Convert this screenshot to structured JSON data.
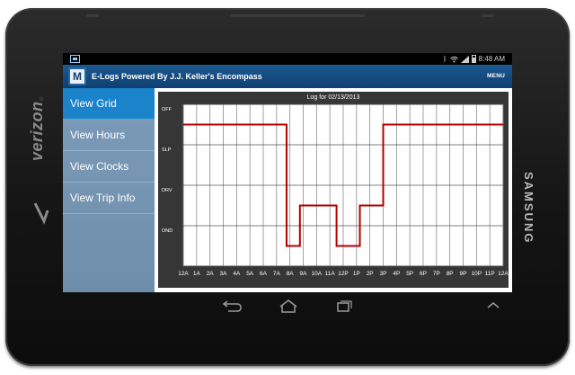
{
  "device": {
    "carrier_logo": "verizon",
    "brand_logo": "SAMSUNG"
  },
  "status_bar": {
    "left_icon": "screenshot-icon",
    "right_icons": [
      "bluetooth-icon",
      "wifi-icon",
      "signal-icon",
      "battery-icon"
    ],
    "time": "8:48 AM"
  },
  "app_bar": {
    "logo_letter": "M",
    "title": "E-Logs Powered By J.J. Keller's Encompass",
    "menu_label": "MENU",
    "color": "#1c5a92"
  },
  "sidebar": {
    "items": [
      {
        "label": "View Grid",
        "active": true
      },
      {
        "label": "View Hours",
        "active": false
      },
      {
        "label": "View Clocks",
        "active": false
      },
      {
        "label": "View Trip Info",
        "active": false
      }
    ],
    "active_color": "#1a83c9"
  },
  "chart_data": {
    "type": "line",
    "title": "Log for 02/13/2013",
    "status_rows": [
      "OFF",
      "SLP",
      "DRV",
      "OND"
    ],
    "x_ticks": [
      "12A",
      "1A",
      "2A",
      "3A",
      "4A",
      "5A",
      "6A",
      "7A",
      "8A",
      "9A",
      "10A",
      "11A",
      "12P",
      "1P",
      "2P",
      "3P",
      "4P",
      "5P",
      "6P",
      "7P",
      "8P",
      "9P",
      "10P",
      "11P",
      "12A"
    ],
    "xlim": [
      0,
      24
    ],
    "grid": true,
    "line_color": "#b30000",
    "segments": [
      {
        "status": "OFF",
        "start": 0,
        "end": 7.75
      },
      {
        "status": "OND",
        "start": 7.75,
        "end": 8.75
      },
      {
        "status": "DRV",
        "start": 8.75,
        "end": 11.5
      },
      {
        "status": "OND",
        "start": 11.5,
        "end": 13.25
      },
      {
        "status": "DRV",
        "start": 13.25,
        "end": 15.0
      },
      {
        "status": "OFF",
        "start": 15.0,
        "end": 24
      }
    ]
  },
  "nav_bar": {
    "buttons": [
      "back-icon",
      "home-icon",
      "recent-apps-icon",
      "menu-up-icon"
    ]
  }
}
